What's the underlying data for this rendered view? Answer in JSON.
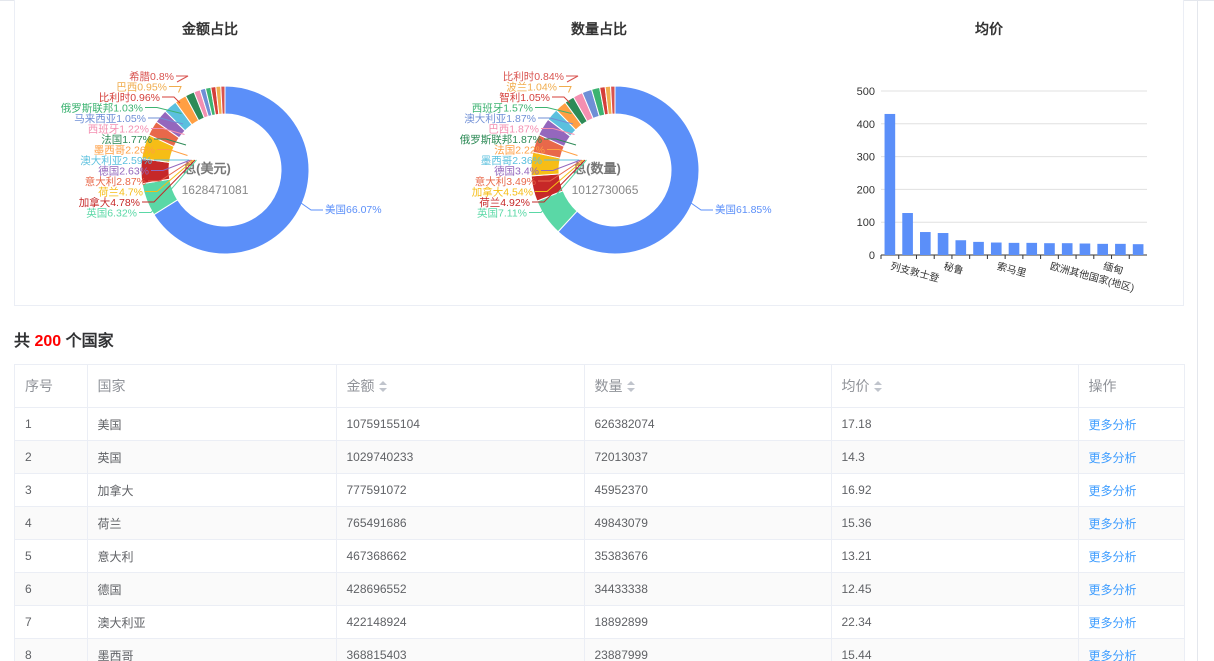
{
  "charts": {
    "amount": {
      "title": "金额占比",
      "center_label": "总(美元)",
      "center_value": "1628471081",
      "labels": [
        {
          "text": "希腊0.8%",
          "color": "#d9534f"
        },
        {
          "text": "巴西0.95%",
          "color": "#f0ad4e"
        },
        {
          "text": "比利时0.96%",
          "color": "#d43f3a"
        },
        {
          "text": "俄罗斯联邦1.03%",
          "color": "#3cb371"
        },
        {
          "text": "马来西亚1.05%",
          "color": "#6f8fd6"
        },
        {
          "text": "西班牙1.22%",
          "color": "#f48fb1"
        },
        {
          "text": "法国1.77%",
          "color": "#2e8b57"
        },
        {
          "text": "墨西哥2.26%",
          "color": "#ff9f43"
        },
        {
          "text": "澳大利亚2.59%",
          "color": "#5bc0de"
        },
        {
          "text": "德国2.63%",
          "color": "#9467bd"
        },
        {
          "text": "意大利2.87%",
          "color": "#e8684a"
        },
        {
          "text": "荷兰4.7%",
          "color": "#f6bd16"
        },
        {
          "text": "加拿大4.78%",
          "color": "#c62828"
        },
        {
          "text": "英国6.32%",
          "color": "#5ad8a6"
        },
        {
          "text": "美国66.07%",
          "color": "#5b8ff9"
        }
      ]
    },
    "quantity": {
      "title": "数量占比",
      "center_label": "总(数量)",
      "center_value": "1012730065",
      "labels": [
        {
          "text": "比利时0.84%",
          "color": "#d9534f"
        },
        {
          "text": "波兰1.04%",
          "color": "#f0ad4e"
        },
        {
          "text": "智利1.05%",
          "color": "#d43f3a"
        },
        {
          "text": "西班牙1.57%",
          "color": "#3cb371"
        },
        {
          "text": "澳大利亚1.87%",
          "color": "#6f8fd6"
        },
        {
          "text": "巴西1.87%",
          "color": "#f48fb1"
        },
        {
          "text": "俄罗斯联邦1.87%",
          "color": "#2e8b57"
        },
        {
          "text": "法国2.22%",
          "color": "#ff9f43"
        },
        {
          "text": "墨西哥2.36%",
          "color": "#5bc0de"
        },
        {
          "text": "德国3.4%",
          "color": "#9467bd"
        },
        {
          "text": "意大利3.49%",
          "color": "#e8684a"
        },
        {
          "text": "加拿大4.54%",
          "color": "#f6bd16"
        },
        {
          "text": "荷兰4.92%",
          "color": "#c62828"
        },
        {
          "text": "英国7.11%",
          "color": "#5ad8a6"
        },
        {
          "text": "美国61.85%",
          "color": "#5b8ff9"
        }
      ]
    },
    "avg": {
      "title": "均价"
    }
  },
  "chart_data": [
    {
      "type": "pie",
      "title": "金额占比",
      "categories": [
        "美国",
        "英国",
        "加拿大",
        "荷兰",
        "意大利",
        "德国",
        "澳大利亚",
        "墨西哥",
        "法国",
        "西班牙",
        "马来西亚",
        "俄罗斯联邦",
        "比利时",
        "巴西",
        "希腊"
      ],
      "values": [
        66.07,
        6.32,
        4.78,
        4.7,
        2.87,
        2.63,
        2.59,
        2.26,
        1.77,
        1.22,
        1.05,
        1.03,
        0.96,
        0.95,
        0.8
      ]
    },
    {
      "type": "pie",
      "title": "数量占比",
      "categories": [
        "美国",
        "英国",
        "荷兰",
        "加拿大",
        "意大利",
        "德国",
        "墨西哥",
        "法国",
        "俄罗斯联邦",
        "巴西",
        "澳大利亚",
        "西班牙",
        "智利",
        "波兰",
        "比利时"
      ],
      "values": [
        61.85,
        7.11,
        4.92,
        4.54,
        3.49,
        3.4,
        2.36,
        2.22,
        1.87,
        1.87,
        1.87,
        1.57,
        1.05,
        1.04,
        0.84
      ]
    },
    {
      "type": "bar",
      "title": "均价",
      "x_tick_labels": [
        "列支敦士登",
        "秘鲁",
        "索马里",
        "欧洲其他国家(地区)",
        "缅甸"
      ],
      "values": [
        430,
        128,
        70,
        67,
        45,
        40,
        38,
        37,
        37,
        36,
        36,
        35,
        34,
        34,
        33
      ],
      "y_ticks": [
        0,
        100,
        200,
        300,
        400,
        500
      ],
      "ylim": [
        0,
        500
      ],
      "color": "#5b8ff9"
    }
  ],
  "summary": {
    "prefix": "共",
    "count": "200",
    "suffix": "个国家"
  },
  "table": {
    "headers": {
      "index": "序号",
      "country": "国家",
      "amount": "金额",
      "quantity": "数量",
      "avg": "均价",
      "action": "操作"
    },
    "action_label": "更多分析",
    "rows": [
      {
        "index": "1",
        "country": "美国",
        "amount": "10759155104",
        "quantity": "626382074",
        "avg": "17.18"
      },
      {
        "index": "2",
        "country": "英国",
        "amount": "1029740233",
        "quantity": "72013037",
        "avg": "14.3"
      },
      {
        "index": "3",
        "country": "加拿大",
        "amount": "777591072",
        "quantity": "45952370",
        "avg": "16.92"
      },
      {
        "index": "4",
        "country": "荷兰",
        "amount": "765491686",
        "quantity": "49843079",
        "avg": "15.36"
      },
      {
        "index": "5",
        "country": "意大利",
        "amount": "467368662",
        "quantity": "35383676",
        "avg": "13.21"
      },
      {
        "index": "6",
        "country": "德国",
        "amount": "428696552",
        "quantity": "34433338",
        "avg": "12.45"
      },
      {
        "index": "7",
        "country": "澳大利亚",
        "amount": "422148924",
        "quantity": "18892899",
        "avg": "22.34"
      },
      {
        "index": "8",
        "country": "墨西哥",
        "amount": "368815403",
        "quantity": "23887999",
        "avg": "15.44"
      }
    ]
  }
}
